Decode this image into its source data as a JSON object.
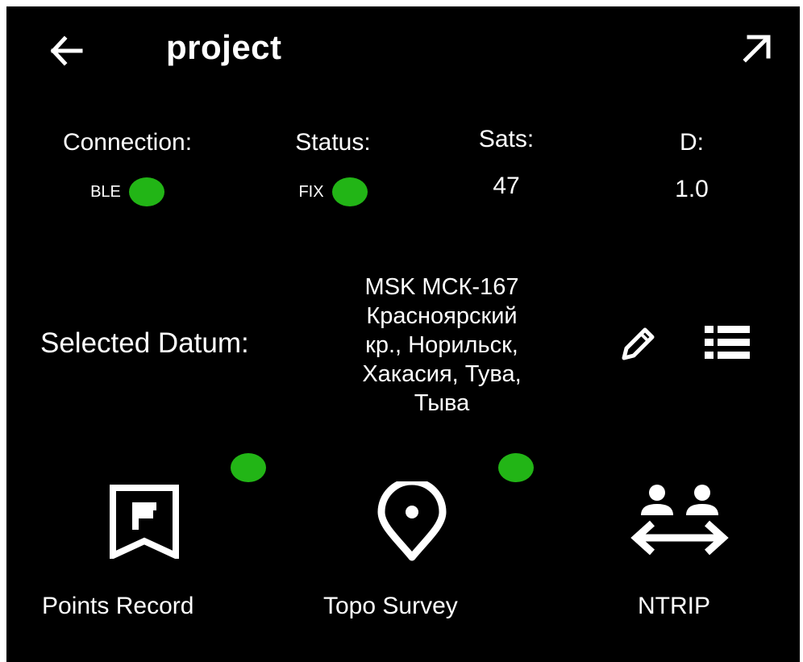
{
  "header": {
    "title": "project",
    "back_icon": "arrow-left-icon",
    "expand_icon": "arrow-up-right-icon"
  },
  "status": {
    "connection": {
      "label": "Connection:",
      "value": "BLE",
      "indicator": "#22b516"
    },
    "fix": {
      "label": "Status:",
      "value": "FIX",
      "indicator": "#22b516"
    },
    "sats": {
      "label": "Sats:",
      "value": "47"
    },
    "d": {
      "label": "D:",
      "value": "1.0"
    }
  },
  "datum": {
    "label": "Selected Datum:",
    "lines": [
      "MSK МСК-167",
      "Красноярский",
      "кр., Норильск,",
      "Хакасия, Тува,",
      "Тыва"
    ],
    "edit_icon": "pencil-icon",
    "list_icon": "list-icon"
  },
  "features": {
    "points_record": {
      "label": "Points Record",
      "icon": "bookmark-flag-icon",
      "status_color": "#22b516"
    },
    "topo_survey": {
      "label": "Topo Survey",
      "icon": "map-pin-icon",
      "status_color": "#22b516"
    },
    "ntrip": {
      "label": "NTRIP",
      "icon": "users-transfer-icon"
    }
  },
  "colors": {
    "background": "#000000",
    "text": "#ffffff",
    "status_ok": "#22b516"
  }
}
